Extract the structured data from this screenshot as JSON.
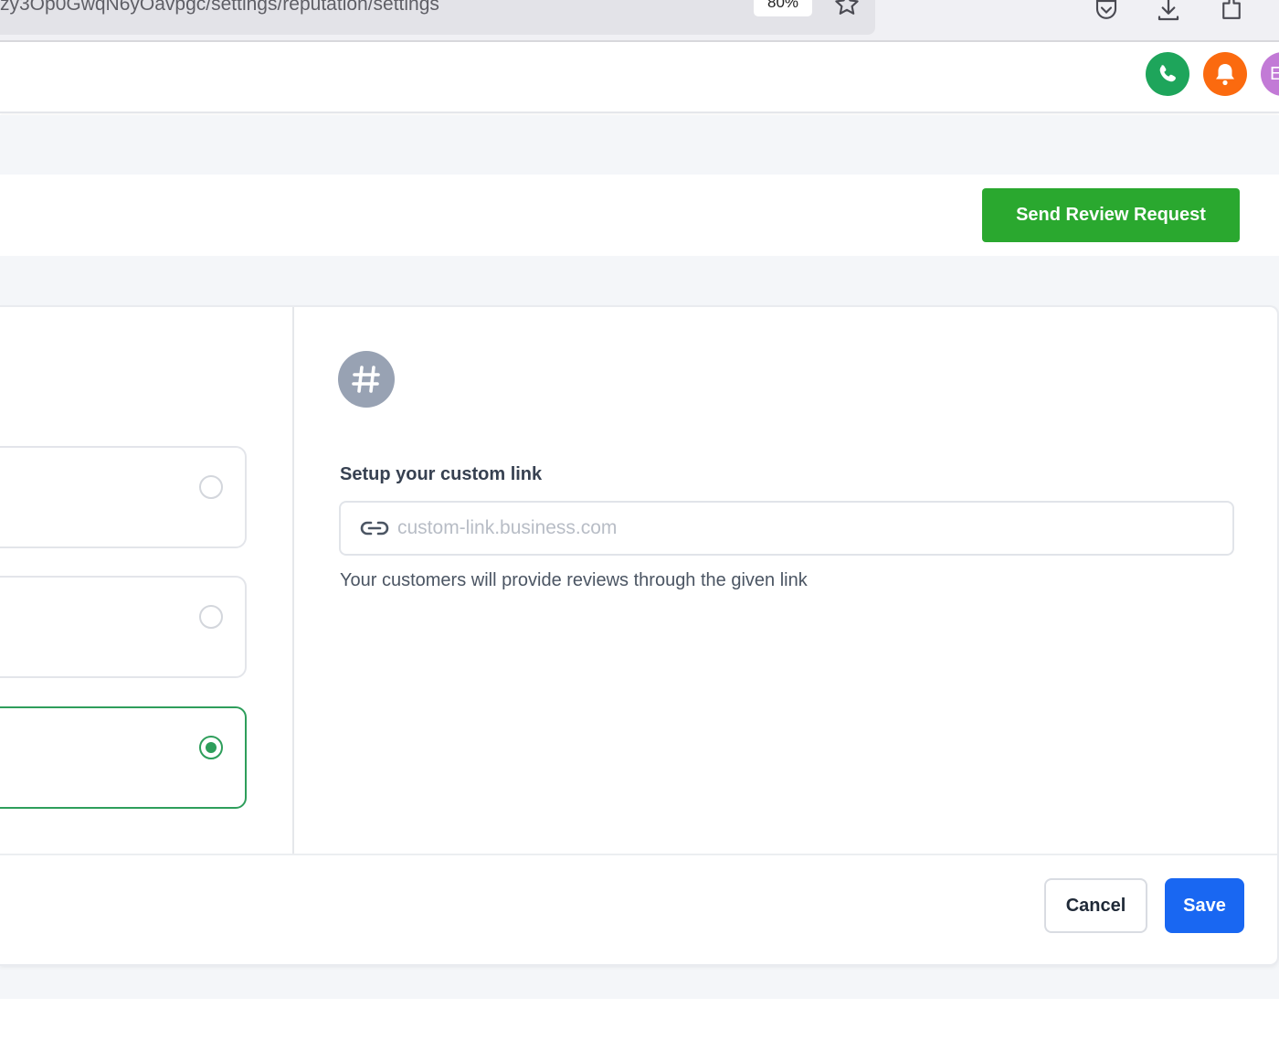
{
  "browser": {
    "url": "zy3Op0GwqN6yOavpgc/settings/reputation/settings",
    "zoom": "80%"
  },
  "header": {
    "avatar_initial": "E",
    "phone_color": "#1ea55b",
    "bell_color": "#fb6a0f"
  },
  "toolbar": {
    "send_review_label": "Send Review Request"
  },
  "options": [
    {
      "selected": false
    },
    {
      "selected": false
    },
    {
      "selected": true
    }
  ],
  "custom_link": {
    "label": "Setup your custom link",
    "placeholder": "custom-link.business.com",
    "value": "",
    "help": "Your customers will provide reviews through the given link"
  },
  "footer": {
    "cancel_label": "Cancel",
    "save_label": "Save"
  }
}
